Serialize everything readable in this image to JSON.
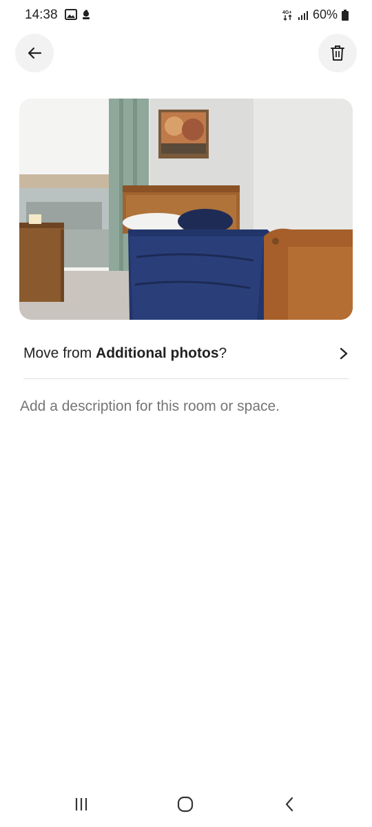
{
  "status_bar": {
    "time": "14:38",
    "network": "4G+",
    "battery": "60%",
    "icons": [
      "gallery-icon",
      "notification-icon",
      "network-4g-icon",
      "signal-icon",
      "battery-icon"
    ]
  },
  "header": {
    "back_icon": "arrow-left-icon",
    "delete_icon": "trash-icon"
  },
  "photo": {
    "subject": "bedroom-photo"
  },
  "move_row": {
    "prefix": "Move from ",
    "section": "Additional photos",
    "suffix": "?",
    "icon": "chevron-right-icon"
  },
  "description": {
    "placeholder": "Add a description for this room or space."
  },
  "nav_bar": {
    "icons": [
      "recents-icon",
      "home-icon",
      "back-icon"
    ]
  },
  "colors": {
    "text": "#222222",
    "muted": "#717171",
    "button_bg": "#f2f2f2",
    "divider": "#dddddd"
  }
}
